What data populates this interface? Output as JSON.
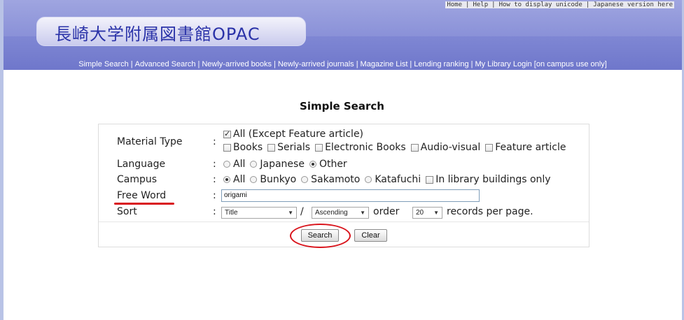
{
  "top_links": [
    "Home",
    "Help",
    "How to display unicode",
    "Japanese version here"
  ],
  "logo": {
    "title": "長崎大学附属図書館OPAC"
  },
  "nav": [
    "Simple Search",
    "Advanced Search",
    "Newly-arrived books",
    "Newly-arrived journals",
    "Magazine List",
    "Lending ranking",
    "My Library Login [on campus use only]"
  ],
  "page_title": "Simple Search",
  "form": {
    "separator": ":",
    "material_type": {
      "label": "Material Type",
      "options": [
        {
          "label": "All (Except Feature article)",
          "checked": true
        },
        {
          "label": "Books",
          "checked": false
        },
        {
          "label": "Serials",
          "checked": false
        },
        {
          "label": "Electronic Books",
          "checked": false
        },
        {
          "label": "Audio-visual",
          "checked": false
        },
        {
          "label": "Feature article",
          "checked": false
        }
      ]
    },
    "language": {
      "label": "Language",
      "options": [
        {
          "label": "All",
          "selected": false
        },
        {
          "label": "Japanese",
          "selected": false
        },
        {
          "label": "Other",
          "selected": true
        }
      ]
    },
    "campus": {
      "label": "Campus",
      "options": [
        {
          "label": "All",
          "selected": true
        },
        {
          "label": "Bunkyo",
          "selected": false
        },
        {
          "label": "Sakamoto",
          "selected": false
        },
        {
          "label": "Katafuchi",
          "selected": false
        }
      ],
      "in_library": {
        "label": "In library buildings only",
        "checked": false
      }
    },
    "free_word": {
      "label": "Free Word",
      "value": "origami"
    },
    "sort": {
      "label": "Sort",
      "field": "Title",
      "slash": "/",
      "order": "Ascending",
      "order_text": "order",
      "per_page": "20",
      "per_page_text": "records per page."
    },
    "search_label": "Search",
    "clear_label": "Clear"
  },
  "colors": {
    "banner": "#7e86d3",
    "logo_text": "#2a32a8",
    "annotation": "#d9141c"
  },
  "icons": {
    "dropdown": "chevron-down-icon"
  }
}
